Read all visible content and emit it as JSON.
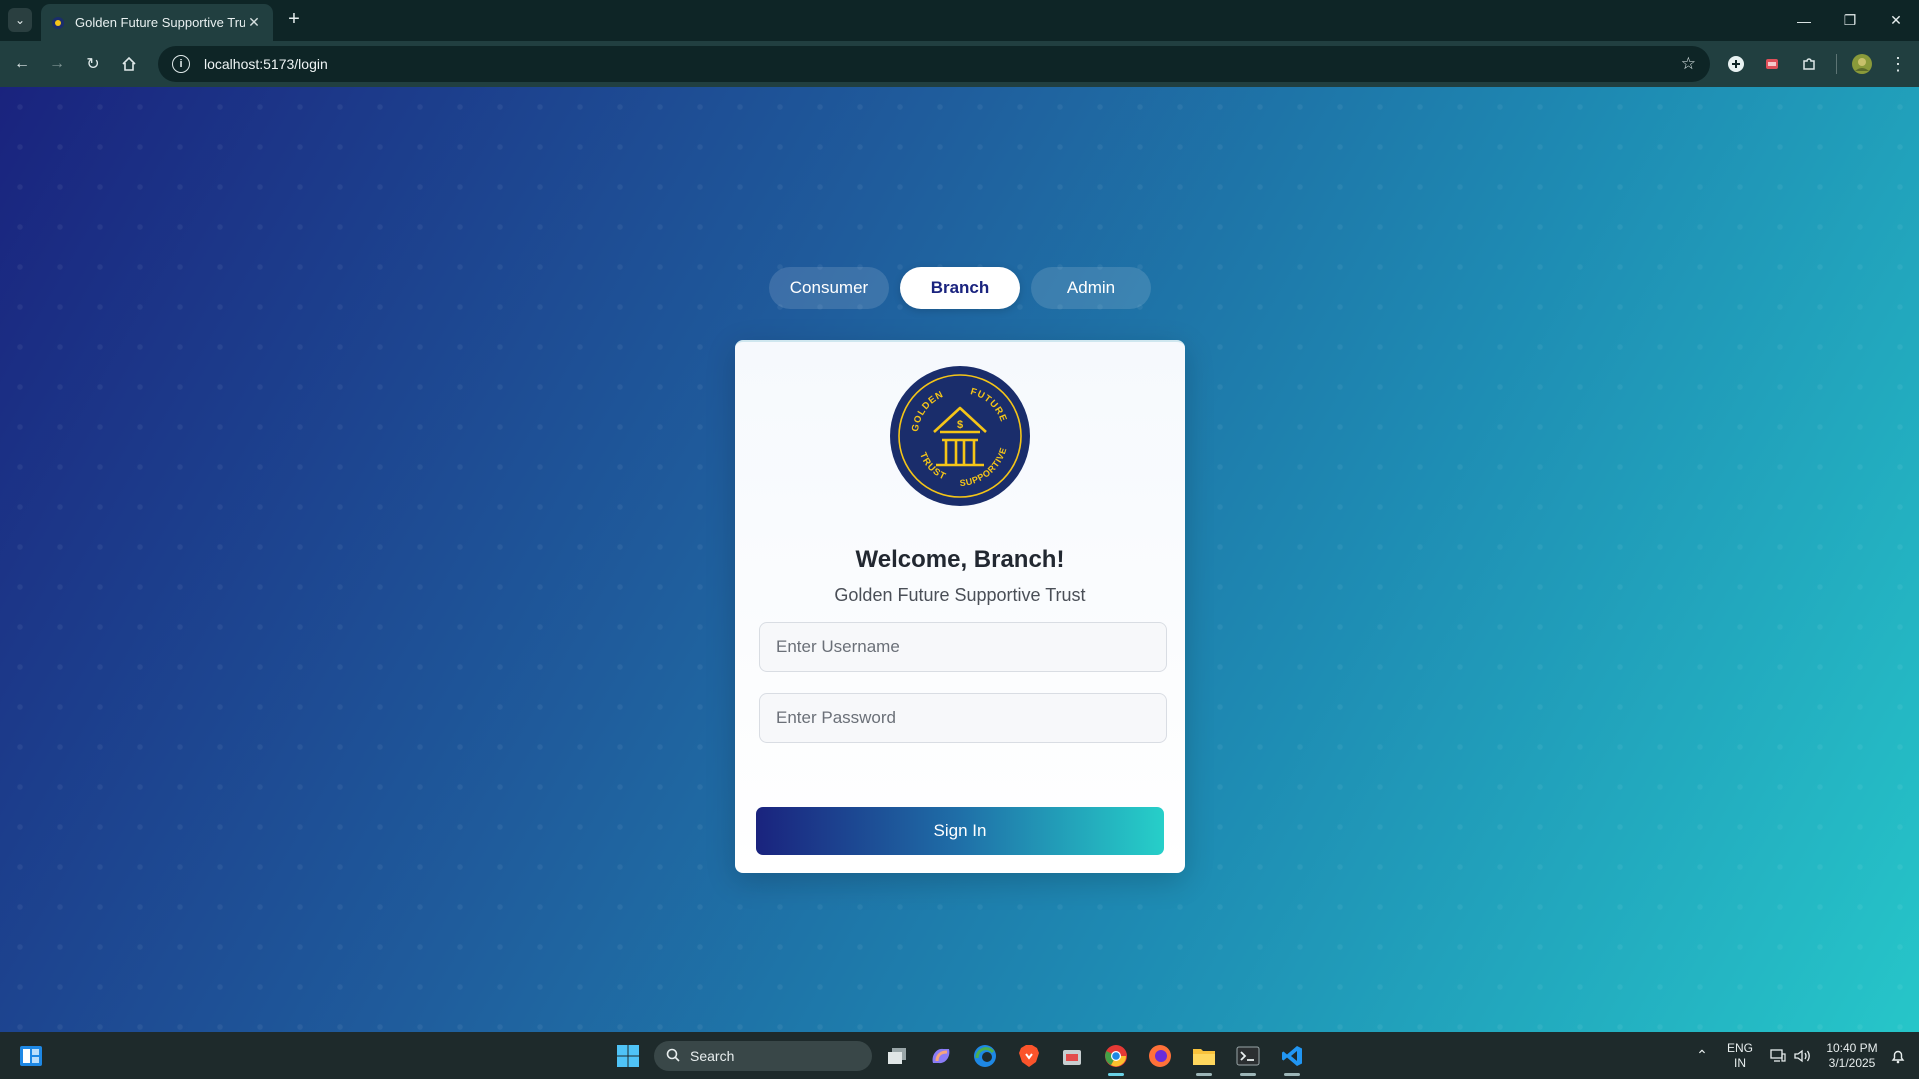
{
  "browser": {
    "tab_title": "Golden Future Supportive Trust",
    "url": "localhost:5173/login"
  },
  "page": {
    "role_tabs": [
      {
        "label": "Consumer",
        "active": false
      },
      {
        "label": "Branch",
        "active": true
      },
      {
        "label": "Admin",
        "active": false
      }
    ],
    "logo": {
      "text_top_left": "GOLDEN",
      "text_top_right": "FUTURE",
      "text_bottom_left": "TRUST",
      "text_bottom_right": "SUPPORTIVE",
      "symbol": "$"
    },
    "welcome": "Welcome, Branch!",
    "subtitle": "Golden Future Supportive Trust",
    "username_placeholder": "Enter Username",
    "password_placeholder": "Enter Password",
    "signin_label": "Sign In"
  },
  "taskbar": {
    "search_label": "Search",
    "language_line1": "ENG",
    "language_line2": "IN",
    "time": "10:40 PM",
    "date": "3/1/2025"
  },
  "colors": {
    "gradient_start": "#1a237e",
    "gradient_end": "#26c6c9",
    "logo_navy": "#1a2d6b",
    "logo_gold": "#f5c518"
  }
}
